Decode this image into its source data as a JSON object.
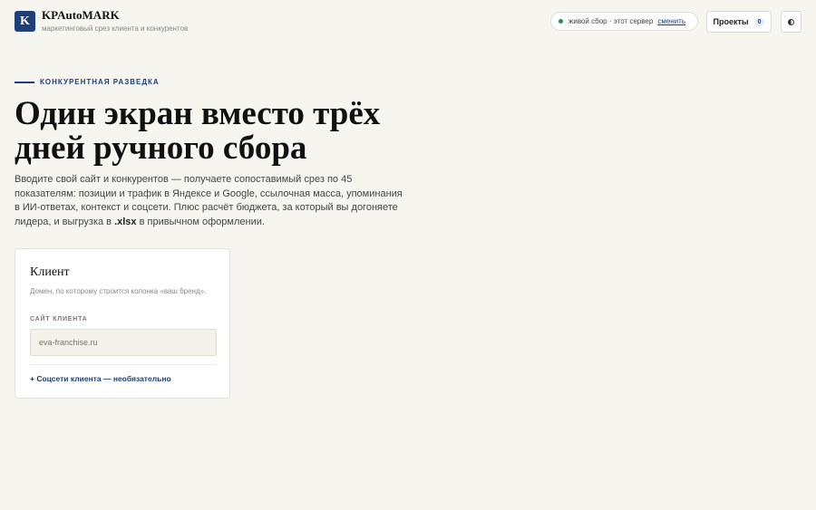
{
  "header": {
    "logo_letter": "K",
    "brand_name": "KPAutoMARK",
    "brand_subtitle": "маркетинговый срез клиента и конкурентов",
    "status": {
      "text": "живой сбор · этот сервер",
      "change_label": "сменить",
      "dot_color": "#2e8b57"
    },
    "projects": {
      "label": "Проекты",
      "count": "0"
    },
    "theme_toggle_icon": "contrast-icon"
  },
  "hero": {
    "eyebrow": "КОНКУРЕНТНАЯ РАЗВЕДКА",
    "title": "Один экран вместо трёх дней ручного сбора",
    "description_before": "Вводите свой сайт и конкурентов — получаете сопоставимый срез по 45 показателям: позиции и трафик в Яндексе и Google, ссылочная масса, упоминания в ИИ-ответах, контекст и соцсети. Плюс расчёт бюджета, за который вы догоняете лидера, и выгрузка в ",
    "description_bold": ".xlsx",
    "description_after": " в привычном оформлении."
  },
  "client_card": {
    "title": "Клиент",
    "hint": "Домен, по которому строится колонка «ваш бренд».",
    "field_label": "САЙТ КЛИЕНТА",
    "field_placeholder": "eva-franchise.ru",
    "field_value": "",
    "social_link": "+ Соцсети клиента — необязательно"
  },
  "colors": {
    "accent": "#1f3f7a",
    "background": "#f6f5f0"
  }
}
